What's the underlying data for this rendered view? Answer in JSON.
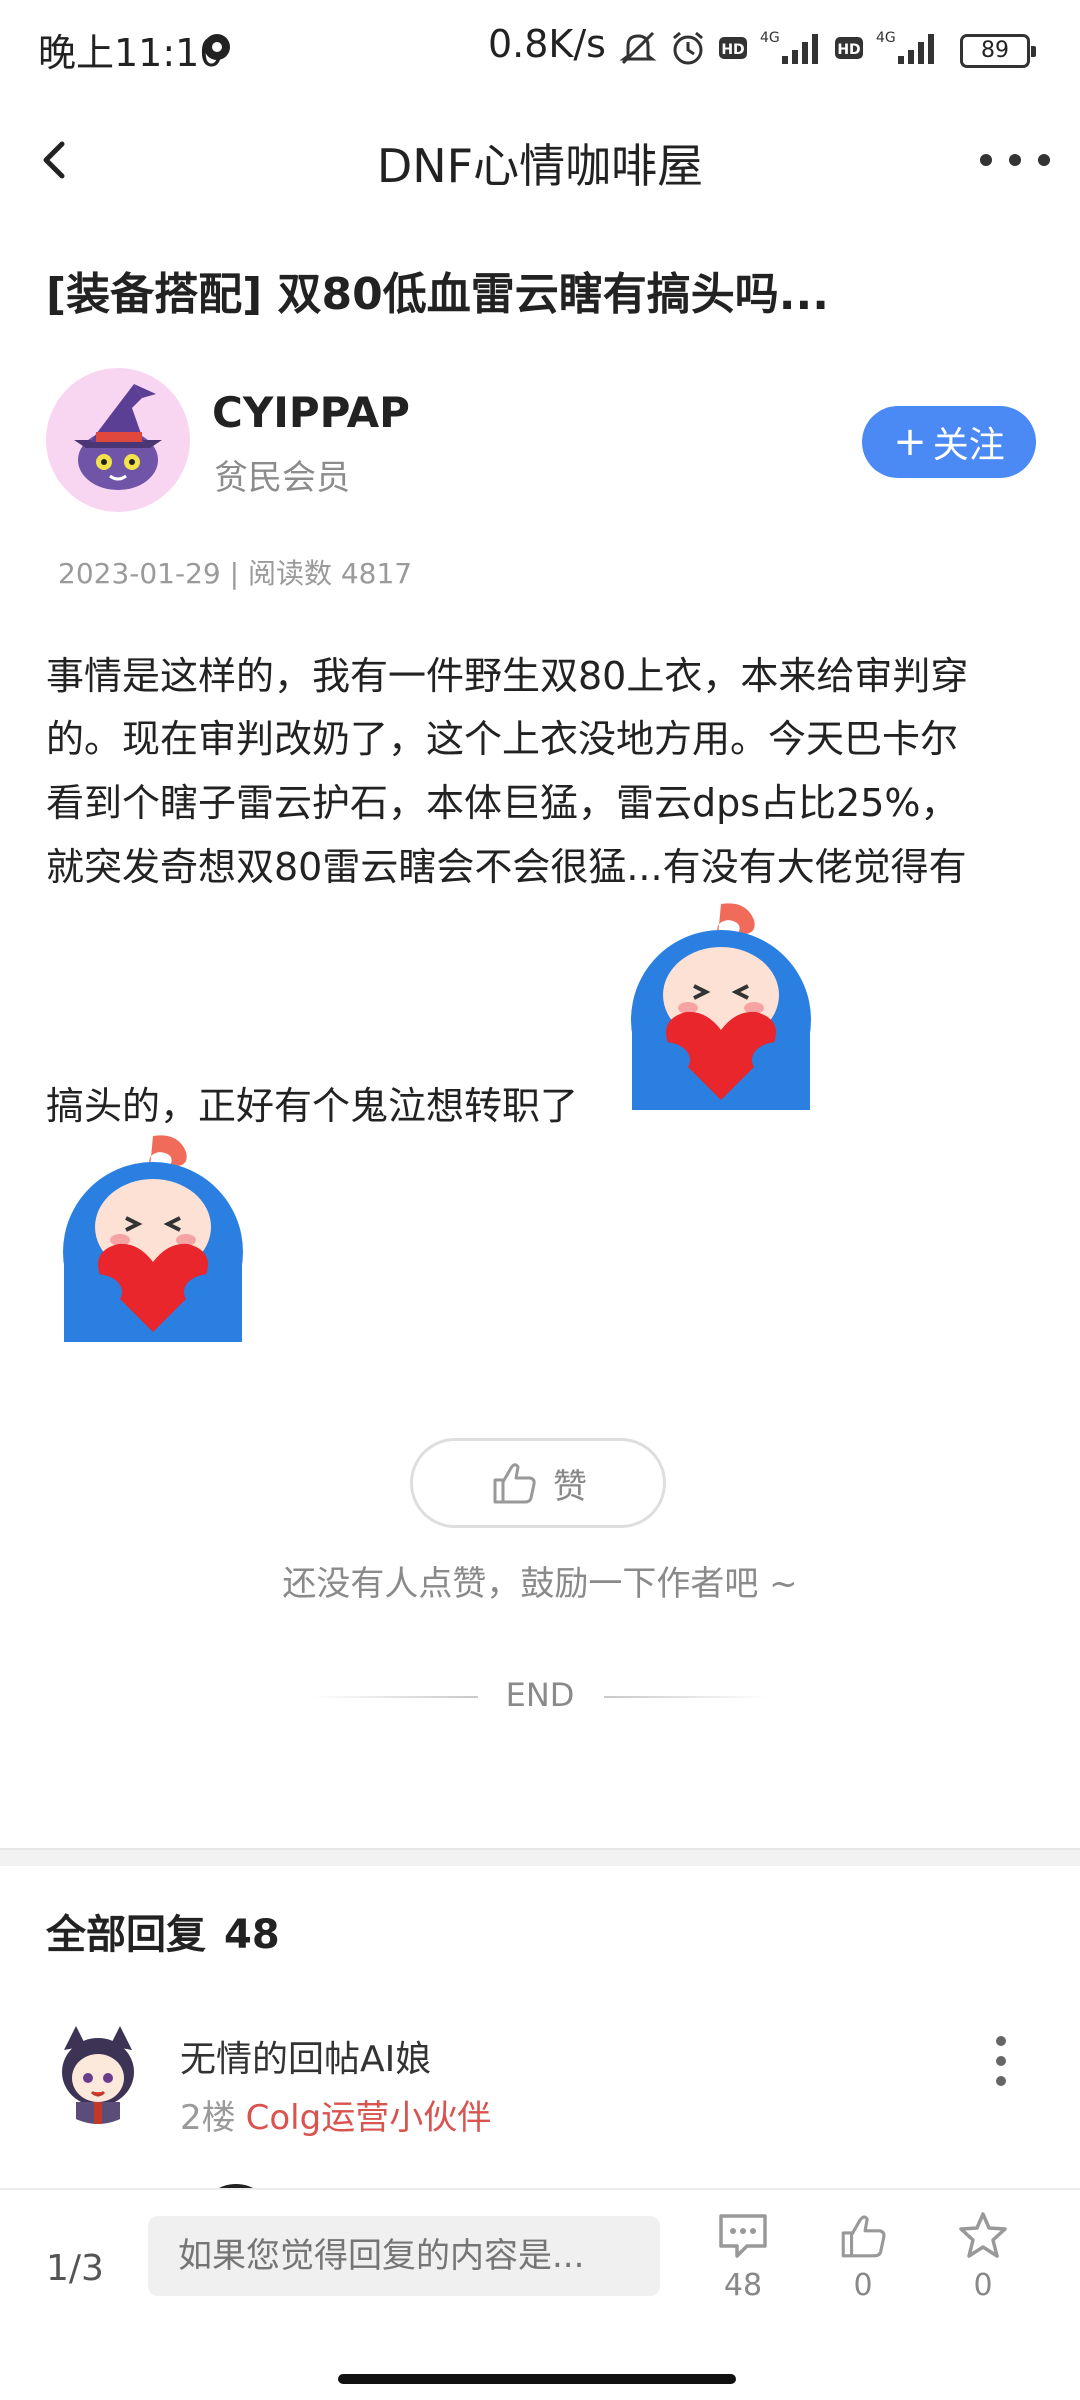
{
  "status_bar": {
    "time": "晚上11:10",
    "net_speed": "0.8K/s",
    "battery": "89",
    "icons": [
      "mute-icon",
      "alarm-icon",
      "hd-icon",
      "signal-4g-icon",
      "hd-icon",
      "signal-4g-icon"
    ]
  },
  "header": {
    "title": "DNF心情咖啡屋",
    "back_icon": "chevron-left-icon",
    "more_icon": "more-icon"
  },
  "post": {
    "title": "[装备搭配] 双80低血雷云瞎有搞头吗...",
    "author": {
      "name": "CYIPPAP",
      "rank": "贫民会员",
      "follow_label": "关注",
      "follow_plus": "+"
    },
    "meta": "2023-01-29 | 阅读数 4817",
    "body_lines": [
      "事情是这样的，我有一件野生双80上衣，本来给审判穿",
      "的。现在审判改奶了，这个上衣没地方用。今天巴卡尔",
      "看到个瞎子雷云护石，本体巨猛，雷云dps占比25%，",
      "就突发奇想双80雷云瞎会不会很猛...有没有大佬觉得有",
      "搞头的，正好有个鬼泣想转职了"
    ]
  },
  "like": {
    "label": "赞",
    "hint": "还没有人点赞，鼓励一下作者吧 ~",
    "end": "END"
  },
  "replies": {
    "title": "全部回复",
    "count": "48",
    "items": [
      {
        "name": "无情的回帖AI娘",
        "floor": "2楼",
        "role": "Colg运营小伙伴"
      }
    ]
  },
  "bottom_bar": {
    "page": "1/3",
    "input_placeholder": "如果您觉得回复的内容是...",
    "comment_count": "48",
    "like_count": "0",
    "fav_count": "0"
  },
  "colors": {
    "accent": "#4b89f4",
    "role_red": "#d9534f",
    "avatar_bg": "#f8d6f1"
  }
}
